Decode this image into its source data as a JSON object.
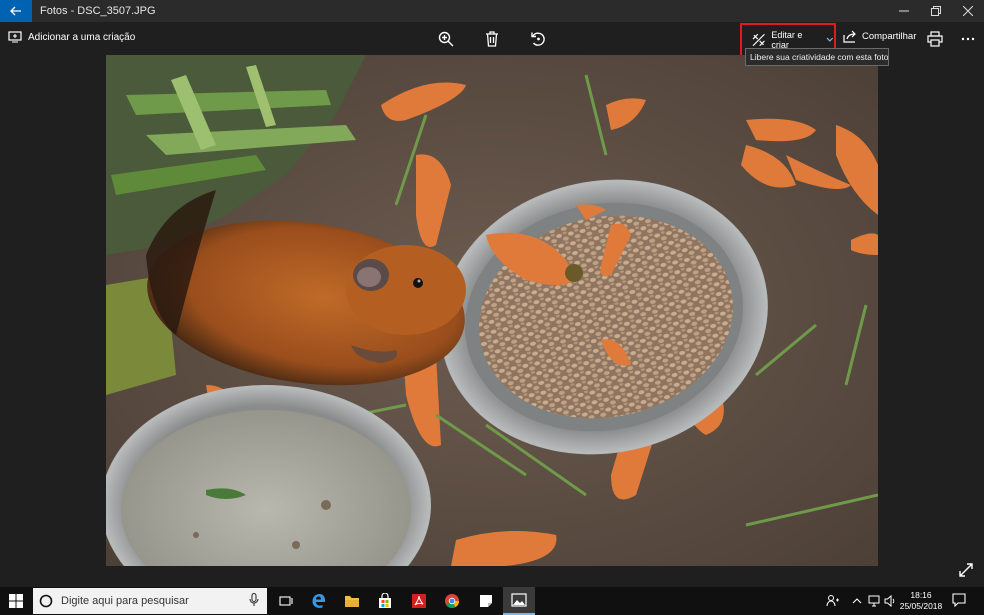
{
  "titlebar": {
    "title": "Fotos - DSC_3507.JPG"
  },
  "toolbar": {
    "add_to_creation": "Adicionar a uma criação",
    "edit_create": "Editar e criar",
    "share": "Compartilhar",
    "tooltip": "Libere sua criatividade com esta foto"
  },
  "taskbar": {
    "search_placeholder": "Digite aqui para pesquisar",
    "time": "18:16",
    "date": "25/05/2018"
  },
  "icons": {
    "back": "back-arrow-icon",
    "minimize": "minimize-icon",
    "restore": "restore-icon",
    "close": "close-icon",
    "zoom": "zoom-in-icon",
    "delete": "trash-icon",
    "rotate": "rotate-icon",
    "print": "print-icon",
    "more": "more-icon"
  },
  "colors": {
    "accent": "#0063b1",
    "highlight_box": "#e01a1f",
    "taskbar_active": "#76b9ed"
  }
}
